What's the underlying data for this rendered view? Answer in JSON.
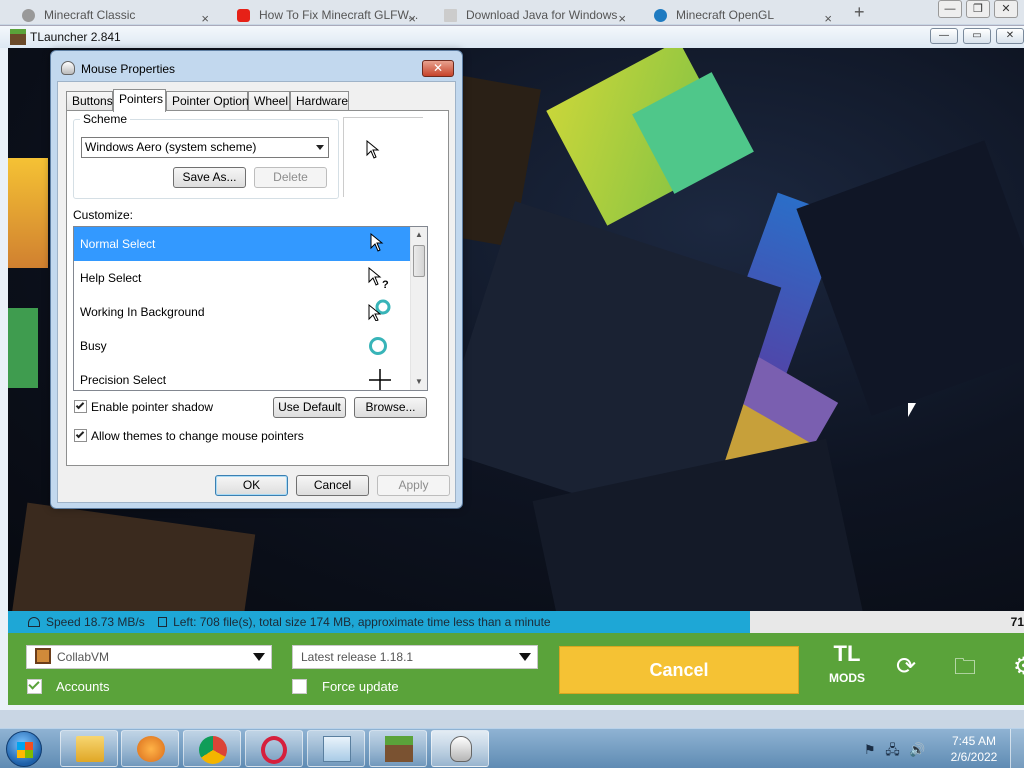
{
  "browser": {
    "tabs": [
      {
        "title": "Minecraft Classic",
        "icon": "globe-icon"
      },
      {
        "title": "How To Fix Minecraft GLFW...",
        "icon": "youtube-icon"
      },
      {
        "title": "Download Java for Windows",
        "icon": "document-icon"
      },
      {
        "title": "Minecraft OpenGL",
        "icon": "edge-icon"
      }
    ],
    "new_tab": "+",
    "close_glyph": "×"
  },
  "launcher": {
    "title": "TLauncher 2.841",
    "progress": {
      "speed": "Speed 18.73 MB/s",
      "left": "Left: 708 file(s), total size 174 MB, approximate time less than a minute",
      "percent_label": "71",
      "fraction": 0.73,
      "color": "#1ea7d6"
    },
    "account_combo": "CollabVM",
    "version_combo": "Latest release 1.18.1",
    "accounts_label": "Accounts",
    "force_update_label": "Force update",
    "cancel_label": "Cancel",
    "logo_top": "TL",
    "logo_bottom": "MODS",
    "accent": "#5aa33a",
    "cancel_color": "#f5c234"
  },
  "dialog": {
    "title": "Mouse Properties",
    "tabs": [
      "Buttons",
      "Pointers",
      "Pointer Options",
      "Wheel",
      "Hardware"
    ],
    "active_tab": "Pointers",
    "scheme_label": "Scheme",
    "scheme_value": "Windows Aero (system scheme)",
    "save_as": "Save As...",
    "delete": "Delete",
    "customize_label": "Customize:",
    "cursors": [
      {
        "name": "Normal Select",
        "icon": "arrow-cursor-icon",
        "selected": true
      },
      {
        "name": "Help Select",
        "icon": "help-cursor-icon",
        "selected": false
      },
      {
        "name": "Working In Background",
        "icon": "working-cursor-icon",
        "selected": false
      },
      {
        "name": "Busy",
        "icon": "busy-cursor-icon",
        "selected": false
      },
      {
        "name": "Precision Select",
        "icon": "crosshair-cursor-icon",
        "selected": false
      }
    ],
    "enable_shadow": "Enable pointer shadow",
    "allow_themes": "Allow themes to change mouse pointers",
    "use_default": "Use Default",
    "browse": "Browse...",
    "ok": "OK",
    "cancel": "Cancel",
    "apply": "Apply"
  },
  "taskbar": {
    "apps": [
      "file-explorer-icon",
      "media-player-icon",
      "chrome-icon",
      "opera-icon",
      "notepad-icon",
      "minecraft-icon",
      "mouse-icon"
    ],
    "time": "7:45 AM",
    "date": "2/6/2022"
  }
}
